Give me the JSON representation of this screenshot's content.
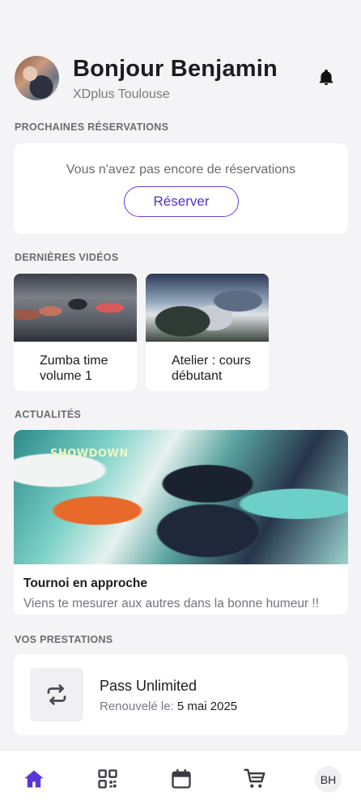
{
  "header": {
    "greeting": "Bonjour Benjamin",
    "club": "XDplus Toulouse"
  },
  "reservations": {
    "section_title": "PROCHAINES RÉSERVATIONS",
    "empty_text": "Vous n'avez pas encore de réservations",
    "button_label": "Réserver"
  },
  "videos": {
    "section_title": "DERNIÈRES VIDÉOS",
    "items": [
      {
        "title": "Zumba time volume 1"
      },
      {
        "title": "Atelier : cours débutant"
      }
    ]
  },
  "news": {
    "section_title": "ACTUALITÉS",
    "image_text": "SHOWDOWN",
    "title": "Tournoi en approche",
    "description": "Viens te mesurer aux autres  dans la bonne humeur !!"
  },
  "prestations": {
    "section_title": "VOS PRESTATIONS",
    "name": "Pass Unlimited",
    "renew_label": "Renouvelé le:",
    "renew_date": "5 mai 2025"
  },
  "tabbar": {
    "items": [
      {
        "icon": "home-icon",
        "active": true
      },
      {
        "icon": "qr-code-icon",
        "active": false
      },
      {
        "icon": "calendar-icon",
        "active": false
      },
      {
        "icon": "cart-icon",
        "active": false
      }
    ],
    "profile_initials": "BH"
  },
  "colors": {
    "accent": "#5a36d6",
    "background": "#f4f4f6",
    "card": "#ffffff",
    "muted_text": "#7a7a82"
  }
}
